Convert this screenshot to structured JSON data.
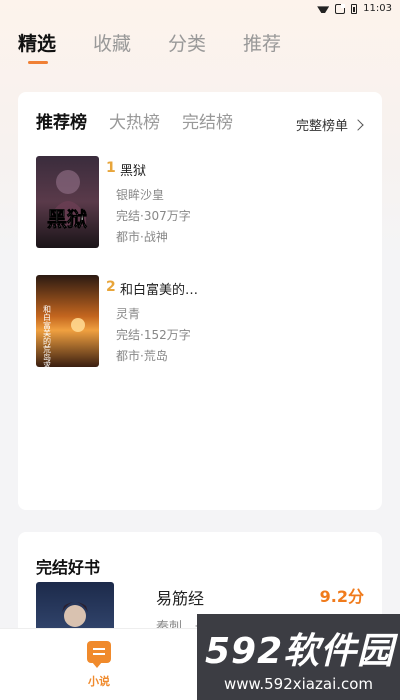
{
  "status_bar": {
    "time": "11:03"
  },
  "main_tabs": [
    {
      "label": "精选",
      "active": true
    },
    {
      "label": "收藏",
      "active": false
    },
    {
      "label": "分类",
      "active": false
    },
    {
      "label": "推荐",
      "active": false
    }
  ],
  "rank_card": {
    "tabs": [
      {
        "label": "推荐榜",
        "active": true
      },
      {
        "label": "大热榜",
        "active": false
      },
      {
        "label": "完结榜",
        "active": false
      }
    ],
    "full_list_label": "完整榜单",
    "books": [
      {
        "rank": "1",
        "title": "黑狱",
        "author": "银眸沙皇",
        "status": "完结·307万字",
        "tags": "都市·战神",
        "cover_text": "黑狱"
      },
      {
        "rank": "2",
        "title": "和白富美的…",
        "author": "灵青",
        "status": "完结·152万字",
        "tags": "都市·荒岛",
        "cover_text": "和白富美的荒岛求生"
      }
    ]
  },
  "finish_card": {
    "title": "完结好书",
    "book": {
      "title": "易筋经",
      "score": "9.2分",
      "desc": "秦刺，一个随爷爷隐居在东北深山"
    }
  },
  "bottom_nav": {
    "items": [
      {
        "label": "小说",
        "active": true
      }
    ]
  },
  "watermark": {
    "main": "592软件园",
    "url": "www.592xiazai.com"
  },
  "colors": {
    "accent": "#f08034",
    "rank_number": "#e8a53a",
    "score": "#f07b1c"
  }
}
